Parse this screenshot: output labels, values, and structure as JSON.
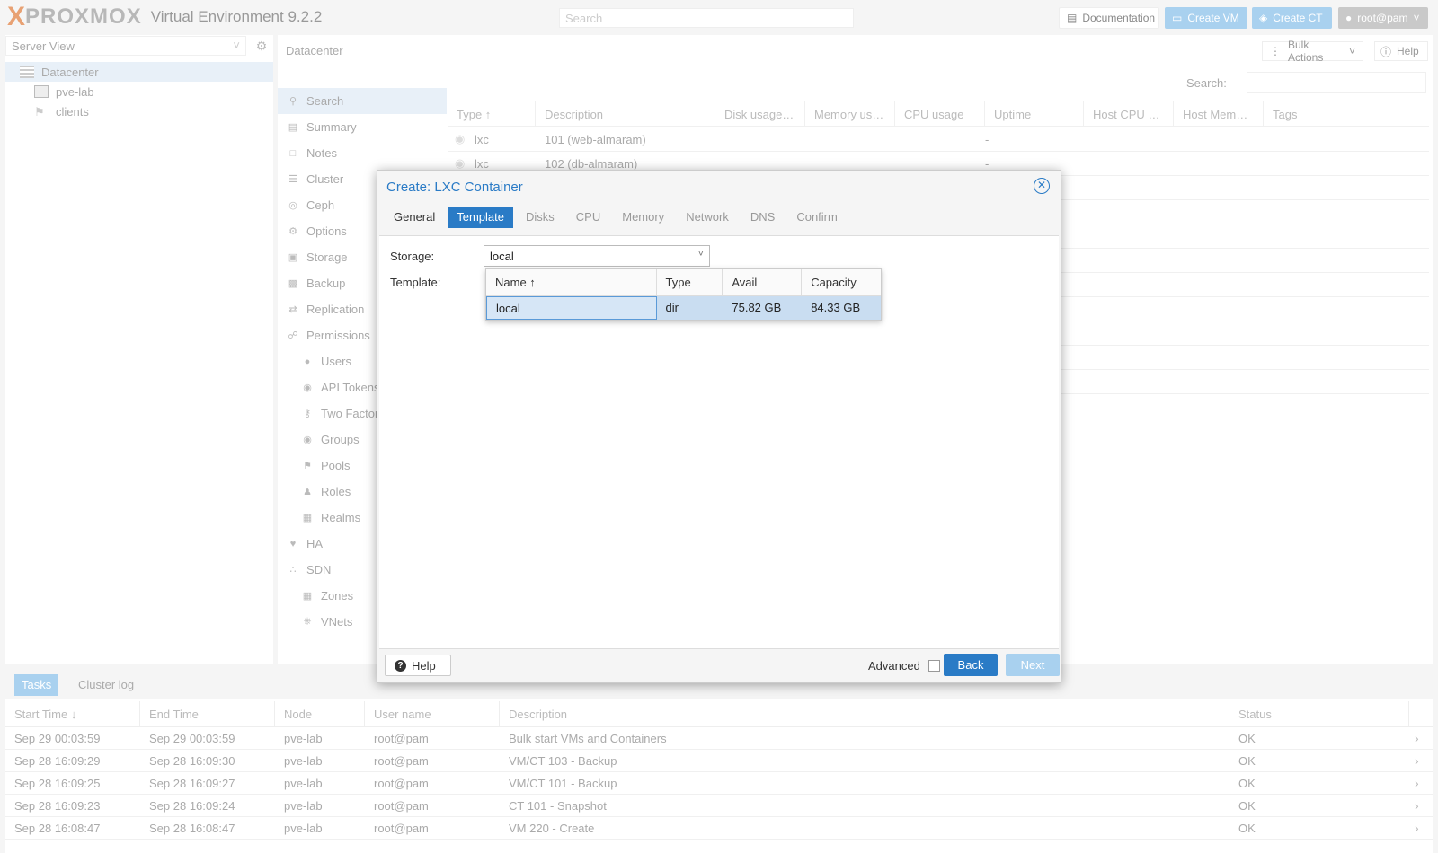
{
  "header": {
    "logo_x": "X",
    "logo_text": "PROXMOX",
    "version": "Virtual Environment 9.2.2",
    "search_placeholder": "Search",
    "documentation_label": "Documentation",
    "create_vm_label": "Create VM",
    "create_ct_label": "Create CT",
    "user_label": "root@pam"
  },
  "left": {
    "view_label": "Server View",
    "tree": [
      {
        "label": "Datacenter",
        "icon": "datacenter-icon"
      },
      {
        "label": "pve-lab",
        "icon": "node-icon"
      },
      {
        "label": "clients",
        "icon": "tags-icon"
      }
    ]
  },
  "main": {
    "breadcrumb": "Datacenter",
    "bulk_actions_label": "Bulk Actions",
    "help_label": "Help",
    "search_label": "Search:",
    "menu": [
      {
        "label": "Search",
        "icon": "search-icon",
        "sub": false
      },
      {
        "label": "Summary",
        "icon": "book-icon",
        "sub": false
      },
      {
        "label": "Notes",
        "icon": "notes-icon",
        "sub": false
      },
      {
        "label": "Cluster",
        "icon": "server-icon",
        "sub": false
      },
      {
        "label": "Ceph",
        "icon": "ceph-icon",
        "sub": false
      },
      {
        "label": "Options",
        "icon": "gear-icon",
        "sub": false
      },
      {
        "label": "Storage",
        "icon": "database-icon",
        "sub": false
      },
      {
        "label": "Backup",
        "icon": "floppy-icon",
        "sub": false
      },
      {
        "label": "Replication",
        "icon": "retweet-icon",
        "sub": false
      },
      {
        "label": "Permissions",
        "icon": "unlock-icon",
        "sub": false
      },
      {
        "label": "Users",
        "icon": "user-icon",
        "sub": true
      },
      {
        "label": "API Tokens",
        "icon": "lock-icon",
        "sub": true
      },
      {
        "label": "Two Factor",
        "icon": "key-icon",
        "sub": true
      },
      {
        "label": "Groups",
        "icon": "users-icon",
        "sub": true
      },
      {
        "label": "Pools",
        "icon": "tags-icon",
        "sub": true
      },
      {
        "label": "Roles",
        "icon": "male-icon",
        "sub": true
      },
      {
        "label": "Realms",
        "icon": "address-book-icon",
        "sub": true
      },
      {
        "label": "HA",
        "icon": "heartbeat-icon",
        "sub": false
      },
      {
        "label": "SDN",
        "icon": "sdn-icon",
        "sub": false
      },
      {
        "label": "Zones",
        "icon": "th-icon",
        "sub": true
      },
      {
        "label": "VNets",
        "icon": "network-icon",
        "sub": true
      }
    ],
    "columns": [
      "Type ↑",
      "Description",
      "Disk usage…",
      "Memory us…",
      "CPU usage",
      "Uptime",
      "Host CPU …",
      "Host Mem…",
      "Tags"
    ],
    "rows": [
      {
        "type": "lxc",
        "description": "101 (web-almaram)",
        "uptime": "-"
      },
      {
        "type": "lxc",
        "description": "102 (db-almaram)",
        "uptime": "-"
      }
    ]
  },
  "tasks": {
    "tab_tasks": "Tasks",
    "tab_log": "Cluster log",
    "columns": [
      "Start Time ↓",
      "End Time",
      "Node",
      "User name",
      "Description",
      "Status"
    ],
    "rows": [
      {
        "start": "Sep 29 00:03:59",
        "end": "Sep 29 00:03:59",
        "node": "pve-lab",
        "user": "root@pam",
        "desc": "Bulk start VMs and Containers",
        "status": "OK"
      },
      {
        "start": "Sep 28 16:09:29",
        "end": "Sep 28 16:09:30",
        "node": "pve-lab",
        "user": "root@pam",
        "desc": "VM/CT 103 - Backup",
        "status": "OK"
      },
      {
        "start": "Sep 28 16:09:25",
        "end": "Sep 28 16:09:27",
        "node": "pve-lab",
        "user": "root@pam",
        "desc": "VM/CT 101 - Backup",
        "status": "OK"
      },
      {
        "start": "Sep 28 16:09:23",
        "end": "Sep 28 16:09:24",
        "node": "pve-lab",
        "user": "root@pam",
        "desc": "CT 101 - Snapshot",
        "status": "OK"
      },
      {
        "start": "Sep 28 16:08:47",
        "end": "Sep 28 16:08:47",
        "node": "pve-lab",
        "user": "root@pam",
        "desc": "VM 220 - Create",
        "status": "OK"
      }
    ]
  },
  "modal": {
    "title": "Create: LXC Container",
    "tabs": [
      "General",
      "Template",
      "Disks",
      "CPU",
      "Memory",
      "Network",
      "DNS",
      "Confirm"
    ],
    "active_tab": "Template",
    "storage_label": "Storage:",
    "storage_value": "local",
    "template_label": "Template:",
    "dropdown_columns": [
      "Name ↑",
      "Type",
      "Avail",
      "Capacity"
    ],
    "dropdown_rows": [
      {
        "name": "local",
        "type": "dir",
        "avail": "75.82 GB",
        "capacity": "84.33 GB"
      }
    ],
    "help_label": "Help",
    "advanced_label": "Advanced",
    "back_label": "Back",
    "next_label": "Next"
  },
  "colors": {
    "accent": "#2a7bc6",
    "accent_light": "#a9d1ef",
    "logo_orange": "#e8a173"
  }
}
